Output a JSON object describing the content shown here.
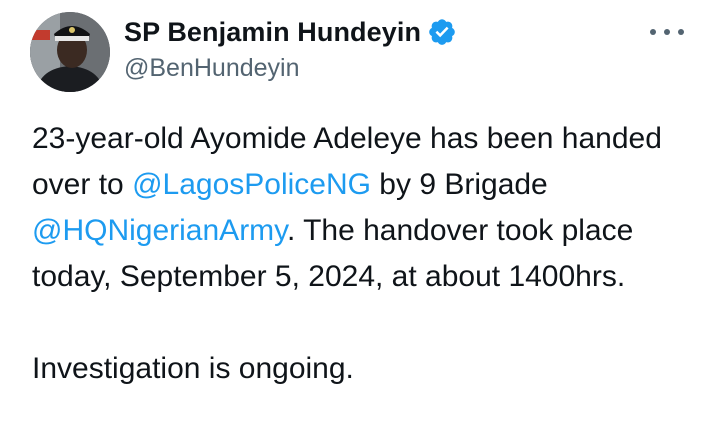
{
  "author": {
    "display_name": "SP Benjamin Hundeyin",
    "handle": "@BenHundeyin",
    "verified": true,
    "avatar": "police-officer-photo",
    "verified_color": "#1d9bf0"
  },
  "menu": {
    "icon": "more-options-icon"
  },
  "tweet": {
    "p1_seg1": "23-year-old Ayomide Adeleye has been handed over to ",
    "mention1": "@LagosPoliceNG",
    "p1_seg2": " by 9 Brigade ",
    "mention2": "@HQNigerianArmy",
    "p1_seg3": ". The handover took place today, September 5, 2024, at about 1400hrs.",
    "p2": "Investigation is ongoing."
  },
  "colors": {
    "text": "#0f1419",
    "secondary": "#536471",
    "link": "#1d9bf0"
  }
}
